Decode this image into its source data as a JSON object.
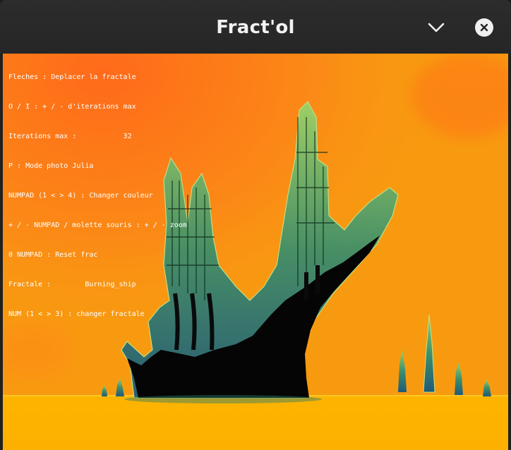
{
  "window": {
    "title": "Fract'ol",
    "buttons": {
      "minimize_icon": "chevron-down-icon",
      "close_icon": "close-icon"
    }
  },
  "canvas": {
    "fractal": "Burning_ship",
    "palette": {
      "background": "#f89a10",
      "glow": "#ff6a1a",
      "edge_green": "#7ec850",
      "edge_blue": "#1e6a8a",
      "interior": "#000000"
    }
  },
  "help": [
    "Fleches : Deplacer la fractale",
    "O / I : + / - d'iterations max",
    "Iterations max :           32",
    "P : Mode photo Julia",
    "NUMPAD (1 < > 4) : Changer couleur",
    "+ / - NUMPAD / molette souris : + / - zoom",
    "0 NUMPAD : Reset frac",
    "Fractale :        Burning_ship",
    "NUM (1 < > 3) : changer fractale"
  ]
}
